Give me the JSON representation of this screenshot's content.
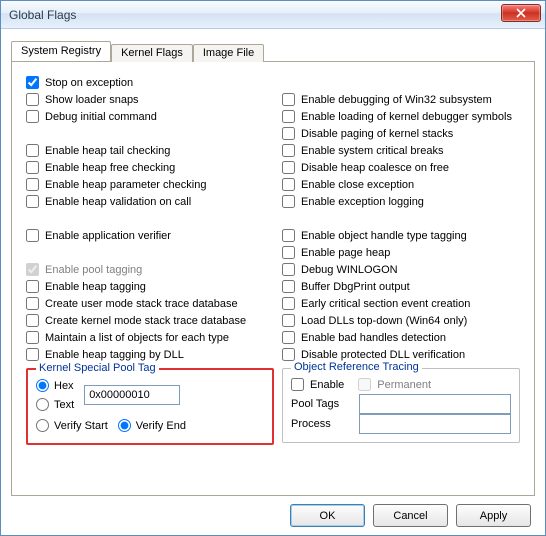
{
  "window": {
    "title": "Global Flags"
  },
  "tabs": {
    "t0": "System Registry",
    "t1": "Kernel Flags",
    "t2": "Image File"
  },
  "left": {
    "c0": "Stop on exception",
    "c1": "Show loader snaps",
    "c2": "Debug initial command",
    "c3": "Enable heap tail checking",
    "c4": "Enable heap free checking",
    "c5": "Enable heap parameter checking",
    "c6": "Enable heap validation on call",
    "c7": "Enable application verifier",
    "c8": "Enable pool tagging",
    "c9": "Enable heap tagging",
    "c10": "Create user mode stack trace database",
    "c11": "Create kernel mode stack trace database",
    "c12": "Maintain a list of objects for each type",
    "c13": "Enable heap tagging by DLL"
  },
  "right": {
    "c0": "Enable debugging of Win32 subsystem",
    "c1": "Enable loading of kernel debugger symbols",
    "c2": "Disable paging of kernel stacks",
    "c3": "Enable system critical breaks",
    "c4": "Disable heap coalesce on free",
    "c5": "Enable close exception",
    "c6": "Enable exception logging",
    "c7": "Enable object handle type tagging",
    "c8": "Enable page heap",
    "c9": "Debug WINLOGON",
    "c10": "Buffer DbgPrint output",
    "c11": "Early critical section event creation",
    "c12": "Load DLLs top-down (Win64 only)",
    "c13": "Enable bad handles detection",
    "c14": "Disable protected DLL verification"
  },
  "pool": {
    "legend": "Kernel Special Pool Tag",
    "hex": "Hex",
    "text": "Text",
    "value": "0x00000010",
    "verify_start": "Verify Start",
    "verify_end": "Verify End"
  },
  "ort": {
    "legend": "Object Reference Tracing",
    "enable": "Enable",
    "permanent": "Permanent",
    "pool_tags_label": "Pool Tags",
    "process_label": "Process",
    "pool_tags_value": "",
    "process_value": ""
  },
  "buttons": {
    "ok": "OK",
    "cancel": "Cancel",
    "apply": "Apply"
  }
}
